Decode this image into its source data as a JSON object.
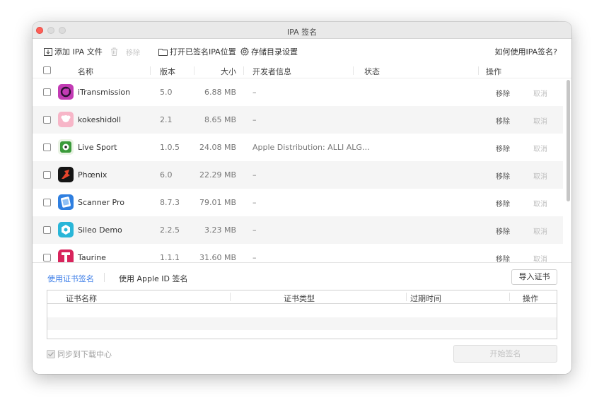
{
  "window": {
    "title": "IPA 签名"
  },
  "toolbar": {
    "add_ipa": "添加 IPA 文件",
    "remove": "移除",
    "open_location": "打开已签名IPA位置",
    "storage_settings": "存储目录设置",
    "help": "如何使用IPA签名?"
  },
  "list": {
    "headers": {
      "name": "名称",
      "version": "版本",
      "size": "大小",
      "developer": "开发者信息",
      "status": "状态",
      "action": "操作"
    },
    "rows": [
      {
        "name": "iTransmission",
        "version": "5.0",
        "size": "6.88 MB",
        "developer": "–",
        "status": "",
        "remove": "移除",
        "cancel": "取消",
        "icon": "itransmission-icon",
        "color": "#c23bb4"
      },
      {
        "name": "kokeshidoll",
        "version": "2.1",
        "size": "8.65 MB",
        "developer": "–",
        "status": "",
        "remove": "移除",
        "cancel": "取消",
        "icon": "kokeshidoll-icon",
        "color": "#f7b6c8"
      },
      {
        "name": "Live Sport",
        "version": "1.0.5",
        "size": "24.08 MB",
        "developer": "Apple Distribution: ALLI ALG…",
        "status": "",
        "remove": "移除",
        "cancel": "取消",
        "icon": "live-sport-icon",
        "color": "#3a9a3a"
      },
      {
        "name": "Phœnix",
        "version": "6.0",
        "size": "22.29 MB",
        "developer": "–",
        "status": "",
        "remove": "移除",
        "cancel": "取消",
        "icon": "phoenix-icon",
        "color": "#1a1a1a"
      },
      {
        "name": "Scanner Pro",
        "version": "8.7.3",
        "size": "79.01 MB",
        "developer": "–",
        "status": "",
        "remove": "移除",
        "cancel": "取消",
        "icon": "scanner-pro-icon",
        "color": "#2f7fe0"
      },
      {
        "name": "Sileo Demo",
        "version": "2.2.5",
        "size": "3.23 MB",
        "developer": "–",
        "status": "",
        "remove": "移除",
        "cancel": "取消",
        "icon": "sileo-icon",
        "color": "#29b6d8"
      },
      {
        "name": "Taurine",
        "version": "1.1.1",
        "size": "31.60 MB",
        "developer": "–",
        "status": "",
        "remove": "移除",
        "cancel": "取消",
        "icon": "taurine-icon",
        "color": "#d8245c"
      }
    ]
  },
  "signing": {
    "tab_cert": "使用证书签名",
    "tab_apple_id": "使用 Apple ID 签名",
    "import_cert": "导入证书",
    "cert_headers": {
      "name": "证书名称",
      "type": "证书类型",
      "expiry": "过期时间",
      "action": "操作"
    },
    "sync_label": "同步到下载中心",
    "start_button": "开始签名"
  }
}
